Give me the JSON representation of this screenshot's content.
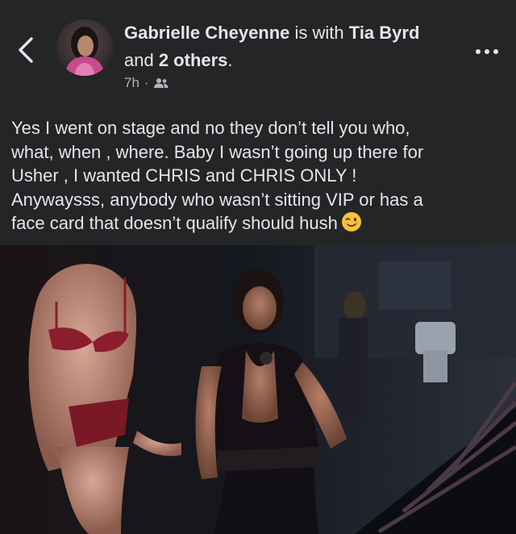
{
  "post": {
    "author_name": "Gabrielle Cheyenne",
    "with_text": " is with ",
    "tagged_name": "Tia Byrd",
    "and_text": " and ",
    "others_text": "2 others",
    "period": ".",
    "time": "7h",
    "separator": "·",
    "audience_icon": "friends-icon",
    "text_lines": [
      "Yes I went on stage and no they don’t tell you who,",
      "what, when , where. Baby I wasn’t going up there for",
      "Usher , I wanted CHRIS and CHRIS ONLY !",
      "Anywaysss, anybody who wasn’t sitting VIP or has a",
      "face card that doesn’t qualify should hush"
    ],
    "emoji": "winking-face-emoji"
  },
  "icons": {
    "back": "chevron-left-icon",
    "more": "more-options-icon"
  },
  "colors": {
    "background": "#242526",
    "text_primary": "#e4e6eb",
    "text_secondary": "#b0b3b8",
    "emoji_yellow": "#f7c23b"
  }
}
